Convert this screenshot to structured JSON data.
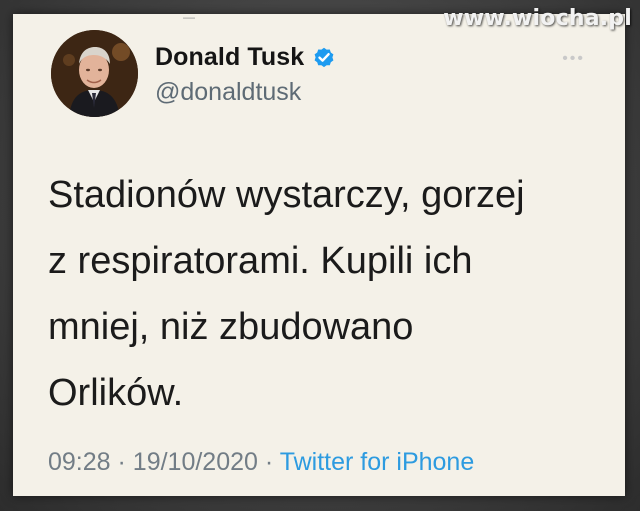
{
  "watermark": "www.wiocha.pl",
  "tweet": {
    "author": {
      "name": "Donald Tusk",
      "handle": "@donaldtusk",
      "verified": true
    },
    "text_lines": [
      "Stadionów wystarczy, gorzej",
      "z respiratorami. Kupili ich",
      "mniej, niż zbudowano",
      "Orlików."
    ],
    "time": "09:28",
    "separator": "·",
    "date": "19/10/2020",
    "source": "Twitter for iPhone"
  },
  "icons": {
    "verified": "verified-badge-icon",
    "more": "more-options-icon"
  },
  "colors": {
    "card_background": "#f4f1e8",
    "name_text": "#151515",
    "handle_text": "#5e6b75",
    "link_blue": "#2d9be0",
    "verified_blue": "#1d9bf0"
  }
}
